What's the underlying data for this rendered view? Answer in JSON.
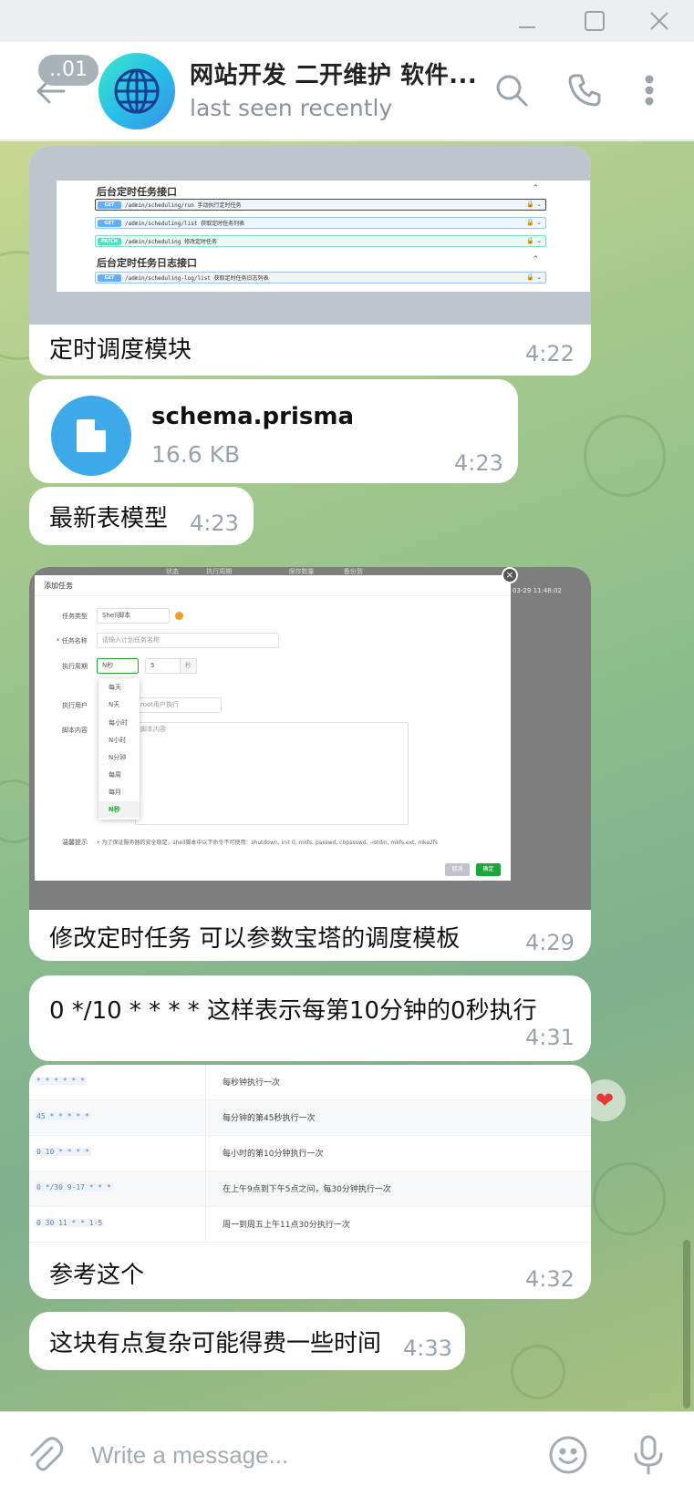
{
  "window": {
    "minimize_icon": "minimize-icon",
    "maximize_icon": "maximize-icon",
    "close_icon": "close-icon"
  },
  "header": {
    "unread_badge": "..01",
    "title": "网站开发 二开维护 软件...",
    "status": "last seen recently",
    "icons": [
      "back-arrow-icon",
      "globe-icon",
      "search-icon",
      "phone-icon",
      "more-vertical-icon"
    ]
  },
  "messages": [
    {
      "type": "image",
      "image": {
        "sections": [
          {
            "title": "后台定时任务接口",
            "rows": [
              {
                "method": "GET",
                "path": "/admin/scheduling/run  手动执行定时任务"
              },
              {
                "method": "GET",
                "path": "/admin/scheduling/list  获取定时任务列表"
              },
              {
                "method": "PATCH",
                "path": "/admin/scheduling  修改定时任务"
              }
            ]
          },
          {
            "title": "后台定时任务日志接口",
            "rows": [
              {
                "method": "GET",
                "path": "/admin/scheduling-log/list  获取定时任务日志列表"
              }
            ]
          }
        ]
      },
      "caption": "定时调度模块",
      "time": "4:22"
    },
    {
      "type": "file",
      "file_name": "schema.prisma",
      "file_size": "16.6 KB",
      "time": "4:23"
    },
    {
      "type": "text",
      "text": "最新表模型",
      "time": "4:23"
    },
    {
      "type": "image",
      "image": {
        "dialog_title": "添加任务",
        "labels": {
          "task_type": "任务类型",
          "task_name": "* 任务名称",
          "period": "执行周期",
          "user": "执行用户",
          "script": "脚本内容",
          "tip": "温馨提示"
        },
        "task_type_value": "Shell脚本",
        "task_name_placeholder": "请输入计划任务名称",
        "period_value": "N秒",
        "period_number": "5",
        "period_unit": "秒",
        "user_placeholder": "root用户执行",
        "script_placeholder": "脚本内容",
        "dropdown_options": [
          "每天",
          "N天",
          "每小时",
          "N小时",
          "N分钟",
          "每周",
          "每月",
          "N秒"
        ],
        "dropdown_selected": "N秒",
        "tip_text": "• 为了保证服务器的安全稳定，shell脚本中以下命令不可使用：shutdown, init 0, mkfs, passwd, chpasswd, --stdin, mkfs.ext, mke2fs",
        "cancel_label": "取消",
        "confirm_label": "确定",
        "background_cols": [
          "状态",
          "执行周期",
          "保存数量",
          "备份到"
        ],
        "background_date": "03-29 11:48:02"
      },
      "caption": "修改定时任务 可以参数宝塔的调度模板",
      "time": "4:29",
      "reaction": "❤"
    },
    {
      "type": "text",
      "text": "0 */10 * * * * 这样表示每第10分钟的0秒执行",
      "time": "4:31"
    },
    {
      "type": "image",
      "image": {
        "rows": [
          {
            "expr": "* * * * * *",
            "desc": "每秒钟执行一次"
          },
          {
            "expr": "45 * * * * *",
            "desc": "每分钟的第45秒执行一次"
          },
          {
            "expr": "0 10 * * * *",
            "desc": "每小时的第10分钟执行一次"
          },
          {
            "expr": "0 */30 9-17 * * *",
            "desc": "在上午9点到下午5点之间，每30分钟执行一次"
          },
          {
            "expr": "0 30 11 * * 1-5",
            "desc": "周一到周五上午11点30分执行一次"
          }
        ]
      },
      "caption": "参考这个",
      "time": "4:32"
    },
    {
      "type": "text",
      "text": "这块有点复杂可能得费一些时间",
      "time": "4:33"
    }
  ],
  "input": {
    "placeholder": "Write a message...",
    "icons": [
      "attach-icon",
      "emoji-icon",
      "microphone-icon"
    ]
  },
  "colors": {
    "accent": "#3da9e8",
    "header_bg": "#ffffff",
    "bubble_bg": "#ffffff",
    "time": "#98a3ad"
  }
}
